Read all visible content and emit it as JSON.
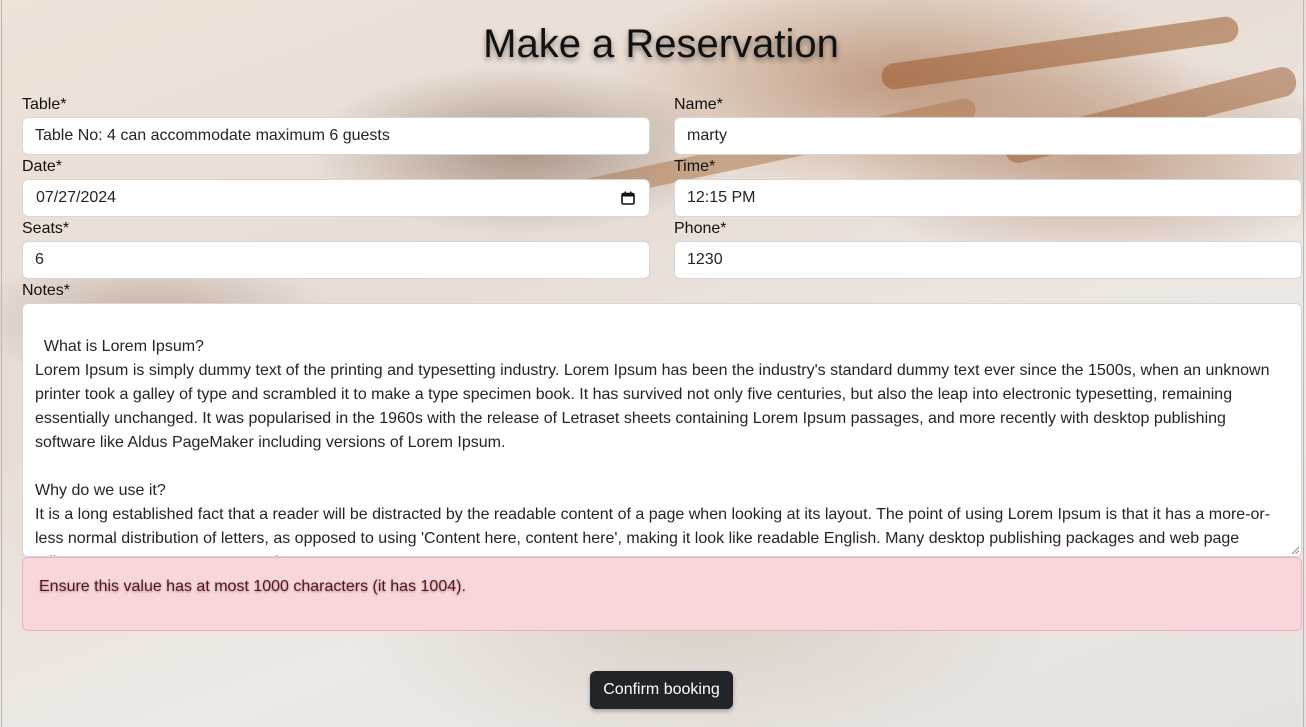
{
  "page": {
    "title": "Make a Reservation"
  },
  "form": {
    "table": {
      "label": "Table*",
      "value": "Table No: 4 can accommodate maximum 6 guests"
    },
    "name": {
      "label": "Name*",
      "value": "marty"
    },
    "date": {
      "label": "Date*",
      "value": "07/27/2024"
    },
    "time": {
      "label": "Time*",
      "value": "12:15 PM"
    },
    "seats": {
      "label": "Seats*",
      "value": "6"
    },
    "phone": {
      "label": "Phone*",
      "value": "1230"
    },
    "notes": {
      "label": "Notes*",
      "value": "What is Lorem Ipsum?\nLorem Ipsum is simply dummy text of the printing and typesetting industry. Lorem Ipsum has been the industry's standard dummy text ever since the 1500s, when an unknown printer took a galley of type and scrambled it to make a type specimen book. It has survived not only five centuries, but also the leap into electronic typesetting, remaining essentially unchanged. It was popularised in the 1960s with the release of Letraset sheets containing Lorem Ipsum passages, and more recently with desktop publishing software like Aldus PageMaker including versions of Lorem Ipsum.\n\nWhy do we use it?\nIt is a long established fact that a reader will be distracted by the readable content of a page when looking at its layout. The point of using Lorem Ipsum is that it has a more-or-less normal distribution of letters, as opposed to using 'Content here, content here', making it look like readable English. Many desktop publishing packages and web page editors now use Lorem Ipsum as th"
    },
    "error_message": "Ensure this value has at most 1000 characters (it has 1004).",
    "submit_label": "Confirm booking"
  },
  "icons": {
    "date_picker": "calendar-icon"
  },
  "colors": {
    "error_bg": "#f8d7da",
    "error_text": "#58151c",
    "button_bg": "#212529"
  }
}
